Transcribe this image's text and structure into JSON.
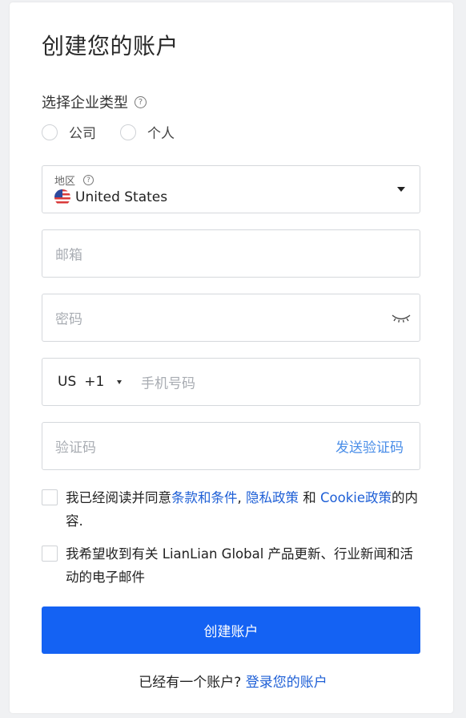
{
  "form": {
    "title": "创建您的账户",
    "business_type": {
      "label": "选择企业类型",
      "options": [
        "公司",
        "个人"
      ]
    },
    "region": {
      "label": "地区",
      "value": "United States"
    },
    "email": {
      "placeholder": "邮箱"
    },
    "password": {
      "placeholder": "密码"
    },
    "phone": {
      "country_code": "US",
      "dial_code": "+1",
      "placeholder": "手机号码"
    },
    "verification": {
      "placeholder": "验证码",
      "send_label": "发送验证码"
    },
    "terms": {
      "prefix": "我已经阅读并同意",
      "terms_link": "条款和条件",
      "sep1": ", ",
      "privacy_link": "隐私政策",
      "and": " 和 ",
      "cookie_link": "Cookie政策",
      "suffix": "的内容."
    },
    "marketing": {
      "text": "我希望收到有关 LianLian Global 产品更新、行业新闻和活动的电子邮件"
    },
    "submit_label": "创建账户",
    "footer": {
      "question": "已经有一个账户? ",
      "login_link": "登录您的账户"
    }
  },
  "colors": {
    "primary": "#1462f3",
    "link": "#1e5fd6",
    "send_code": "#4a8ee8",
    "placeholder": "#a9adb3",
    "border": "#d5d8dc"
  },
  "icons": {
    "help": "question-circle-icon",
    "flag": "us-flag-icon",
    "dropdown": "caret-down-icon",
    "password_toggle": "eye-closed-icon"
  }
}
